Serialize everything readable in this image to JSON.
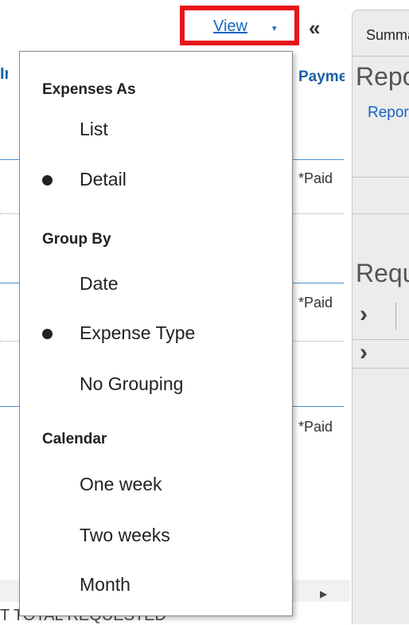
{
  "header": {
    "view_label": "View",
    "view_arrow": "▾",
    "collapse_glyph": "«"
  },
  "table": {
    "left_col_header": "Ir",
    "payment_col_header": "Payment",
    "paid_cells": [
      "*Paid",
      "*Paid",
      "*Paid"
    ],
    "bottom_text": "T                TOTAL REQUESTED"
  },
  "right_panel": {
    "tab_label": "Summary",
    "report_title": "Report",
    "report_sub": "Report",
    "requested_title": "Requested"
  },
  "menu": {
    "sections": [
      {
        "label": "Expenses As",
        "items": [
          {
            "label": "List",
            "selected": false
          },
          {
            "label": "Detail",
            "selected": true
          }
        ]
      },
      {
        "label": "Group By",
        "items": [
          {
            "label": "Date",
            "selected": false
          },
          {
            "label": "Expense Type",
            "selected": true
          },
          {
            "label": "No Grouping",
            "selected": false
          }
        ]
      },
      {
        "label": "Calendar",
        "items": [
          {
            "label": "One week",
            "selected": false
          },
          {
            "label": "Two weeks",
            "selected": false
          },
          {
            "label": "Month",
            "selected": false
          }
        ]
      }
    ]
  },
  "colors": {
    "highlight": "#e8141a",
    "link": "#1565c0"
  }
}
